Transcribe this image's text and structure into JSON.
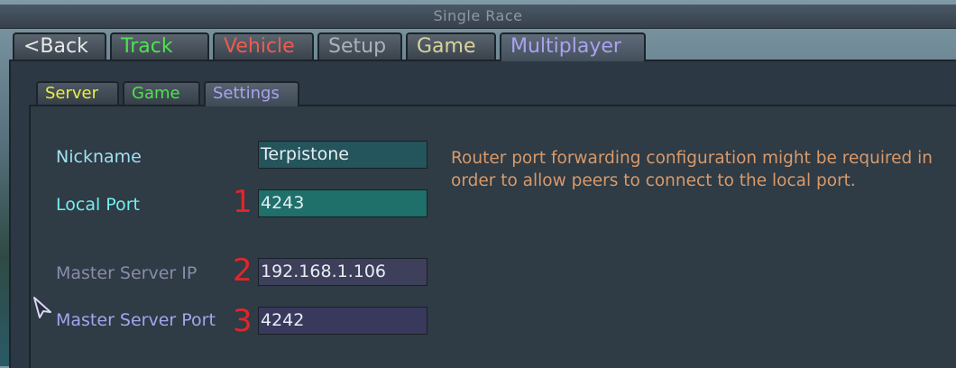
{
  "window": {
    "title": "Single Race"
  },
  "main_tabs": [
    {
      "label": "<Back",
      "color": "#e8e8e8"
    },
    {
      "label": "Track",
      "color": "#4fe24f"
    },
    {
      "label": "Vehicle",
      "color": "#ef5a50"
    },
    {
      "label": "Setup",
      "color": "#aab2ba"
    },
    {
      "label": "Game",
      "color": "#d8d39a"
    },
    {
      "label": "Multiplayer",
      "color": "#aaa2ee"
    }
  ],
  "sub_tabs": [
    {
      "label": "Server",
      "color": "#eeee44"
    },
    {
      "label": "Game",
      "color": "#4fe24f"
    },
    {
      "label": "Settings",
      "color": "#aaa2ee"
    }
  ],
  "form": {
    "nickname": {
      "label": "Nickname",
      "value": "Terpistone"
    },
    "local_port": {
      "label": "Local Port",
      "value": "4243",
      "marker": "1"
    },
    "master_server_ip": {
      "label": "Master Server IP",
      "value": "192.168.1.106",
      "marker": "2"
    },
    "master_server_port": {
      "label": "Master Server Port",
      "value": "4242",
      "marker": "3"
    }
  },
  "note": "Router port forwarding configuration might be required in order to allow peers to connect to the local port.",
  "icons": {
    "cursor": "arrow-cursor-icon"
  }
}
